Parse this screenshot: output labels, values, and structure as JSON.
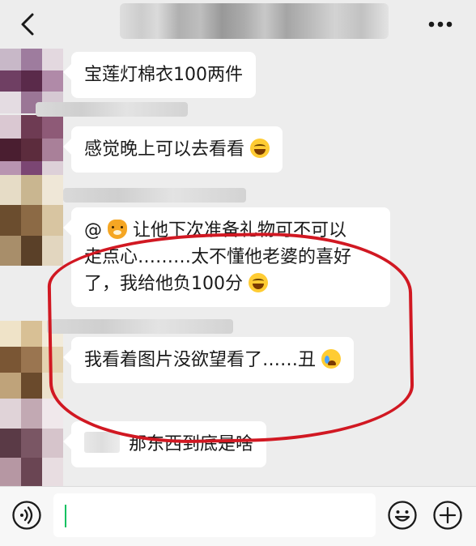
{
  "header": {
    "back_icon": "chevron-left-icon",
    "more_icon": "more-dots-icon"
  },
  "messages": [
    {
      "text": "宝莲灯棉衣100两件"
    },
    {
      "text": "感觉晚上可以去看看",
      "emoji": "laughing-tears-emoji"
    },
    {
      "line1_prefix": "@",
      "line1_rest": "让他下次准备礼物可不可以",
      "line2": "走点心………太不懂他老婆的喜好",
      "line3": "了，我给他负100分",
      "mention_emoji": "tiger-emoji",
      "emoji": "laughing-tears-emoji"
    },
    {
      "text": "我看着图片没欲望看了……丑",
      "emoji": "crying-emoji"
    },
    {
      "text": "那东西到底是啥"
    }
  ],
  "input": {
    "value": "",
    "voice_icon": "voice-icon",
    "emoji_icon": "smiley-icon",
    "plus_icon": "plus-icon"
  },
  "colors": {
    "background": "#ededed",
    "bubble": "#ffffff",
    "highlight_ring": "#d11822",
    "caret": "#07c160"
  }
}
